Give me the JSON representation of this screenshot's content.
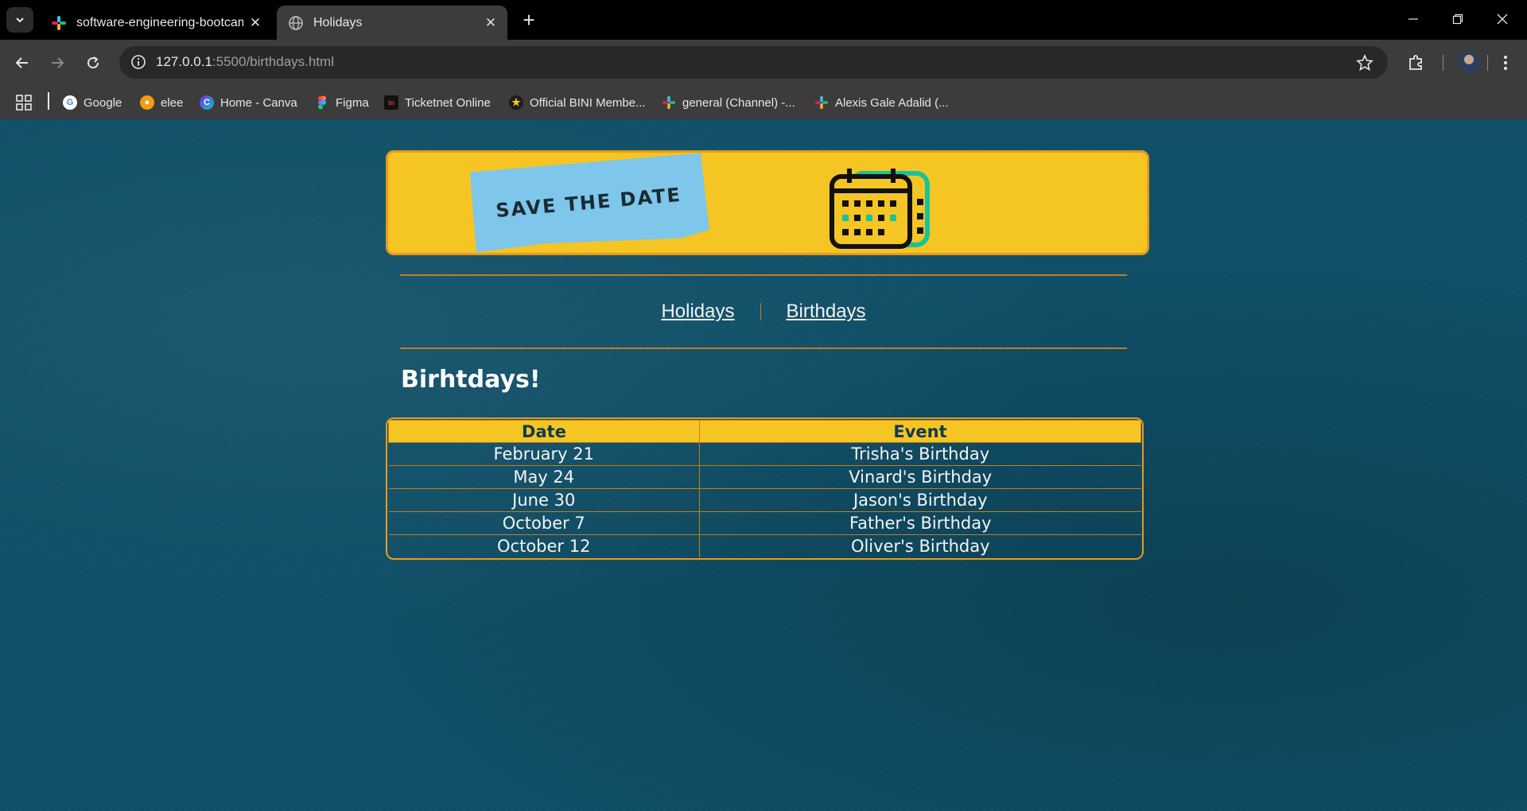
{
  "browser": {
    "tabs": [
      {
        "title": "software-engineering-bootcamp",
        "active": false
      },
      {
        "title": "Holidays",
        "active": true
      }
    ],
    "url_host": "127.0.0.1",
    "url_rest": ":5500/birthdays.html",
    "bookmarks": [
      {
        "label": "Google",
        "icon": "google-icon"
      },
      {
        "label": "elee",
        "icon": "elee-icon"
      },
      {
        "label": "Home - Canva",
        "icon": "canva-icon"
      },
      {
        "label": "Figma",
        "icon": "figma-icon"
      },
      {
        "label": "Ticketnet Online",
        "icon": "ticketnet-icon"
      },
      {
        "label": "Official BINI Membe...",
        "icon": "star-icon"
      },
      {
        "label": "general (Channel) -...",
        "icon": "slack-icon"
      },
      {
        "label": "Alexis Gale Adalid (...",
        "icon": "slack-icon"
      }
    ]
  },
  "banner": {
    "sticker_text": "SAVE THE DATE"
  },
  "nav": {
    "links": [
      {
        "label": "Holidays"
      },
      {
        "label": "Birthdays"
      }
    ]
  },
  "page": {
    "heading": "Birhtdays!"
  },
  "table": {
    "headers": [
      "Date",
      "Event"
    ],
    "rows": [
      {
        "date": "February 21",
        "event": "Trisha's Birthday"
      },
      {
        "date": "May 24",
        "event": "Vinard's Birthday"
      },
      {
        "date": "June 30",
        "event": "Jason's Birthday"
      },
      {
        "date": "October 7",
        "event": "Father's Birthday"
      },
      {
        "date": "October 12",
        "event": "Oliver's Birthday"
      }
    ]
  },
  "colors": {
    "page_background": "#0e4f68",
    "accent_yellow": "#f5c524",
    "accent_orange": "#e99a1a",
    "sticker_blue": "#7ec6ea",
    "calendar_green": "#19c39a"
  }
}
